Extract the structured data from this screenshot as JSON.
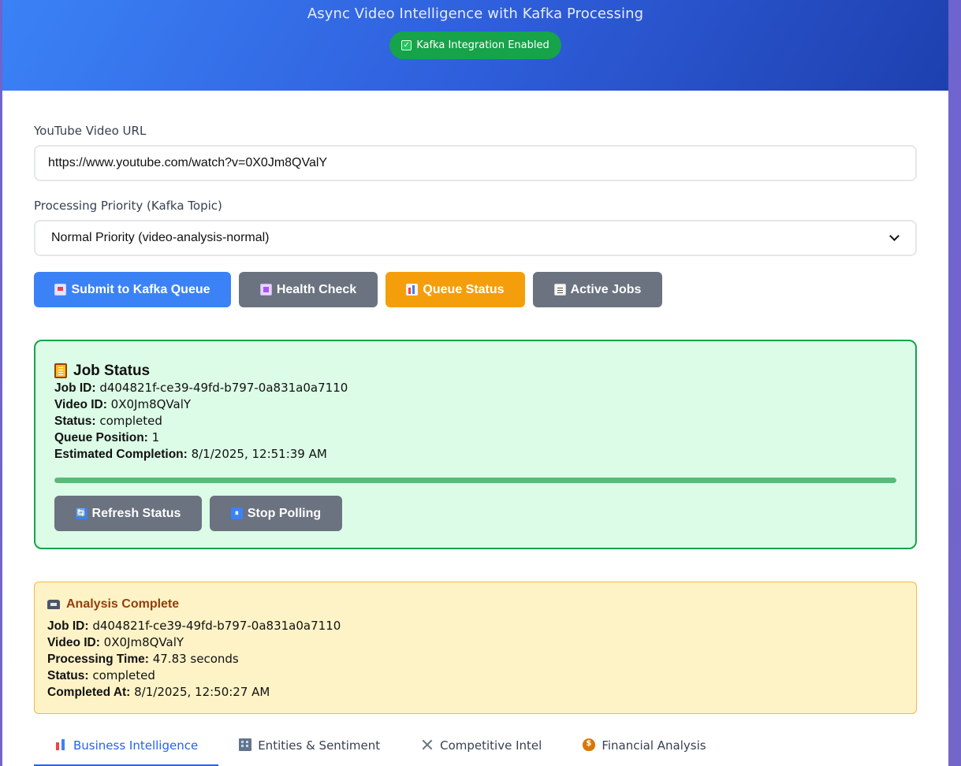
{
  "header": {
    "subtitle": "Async Video Intelligence with Kafka Processing",
    "badge": "Kafka Integration Enabled"
  },
  "form": {
    "url_label": "YouTube Video URL",
    "url_value": "https://www.youtube.com/watch?v=0X0Jm8QValY",
    "priority_label": "Processing Priority (Kafka Topic)",
    "priority_selected": "Normal Priority (video-analysis-normal)"
  },
  "actions": {
    "submit": "Submit to Kafka Queue",
    "health": "Health Check",
    "queue": "Queue Status",
    "active": "Active Jobs"
  },
  "job_status": {
    "title": "Job Status",
    "job_id_label": "Job ID:",
    "job_id": "d404821f-ce39-49fd-b797-0a831a0a7110",
    "video_id_label": "Video ID:",
    "video_id": "0X0Jm8QValY",
    "status_label": "Status:",
    "status": "completed",
    "queue_position_label": "Queue Position:",
    "queue_position": "1",
    "estimated_label": "Estimated Completion:",
    "estimated": "8/1/2025, 12:51:39 AM",
    "progress": 1.0,
    "refresh": "Refresh Status",
    "stop": "Stop Polling"
  },
  "analysis": {
    "title": "Analysis Complete",
    "job_id_label": "Job ID:",
    "job_id": "d404821f-ce39-49fd-b797-0a831a0a7110",
    "video_id_label": "Video ID:",
    "video_id": "0X0Jm8QValY",
    "processing_time_label": "Processing Time:",
    "processing_time": "47.83 seconds",
    "status_label": "Status:",
    "status": "completed",
    "completed_at_label": "Completed At:",
    "completed_at": "8/1/2025, 12:50:27 AM"
  },
  "tabs": [
    {
      "label": "Business Intelligence",
      "icon": "bar-chart-icon",
      "active": true
    },
    {
      "label": "Entities & Sentiment",
      "icon": "building-icon",
      "active": false
    },
    {
      "label": "Competitive Intel",
      "icon": "crossed-swords-icon",
      "active": false
    },
    {
      "label": "Financial Analysis",
      "icon": "money-bag-icon",
      "active": false
    }
  ],
  "colors": {
    "primary": "#3b82f6",
    "success": "#16a34a",
    "warning": "#f59e0b",
    "neutral": "#6b7280"
  }
}
